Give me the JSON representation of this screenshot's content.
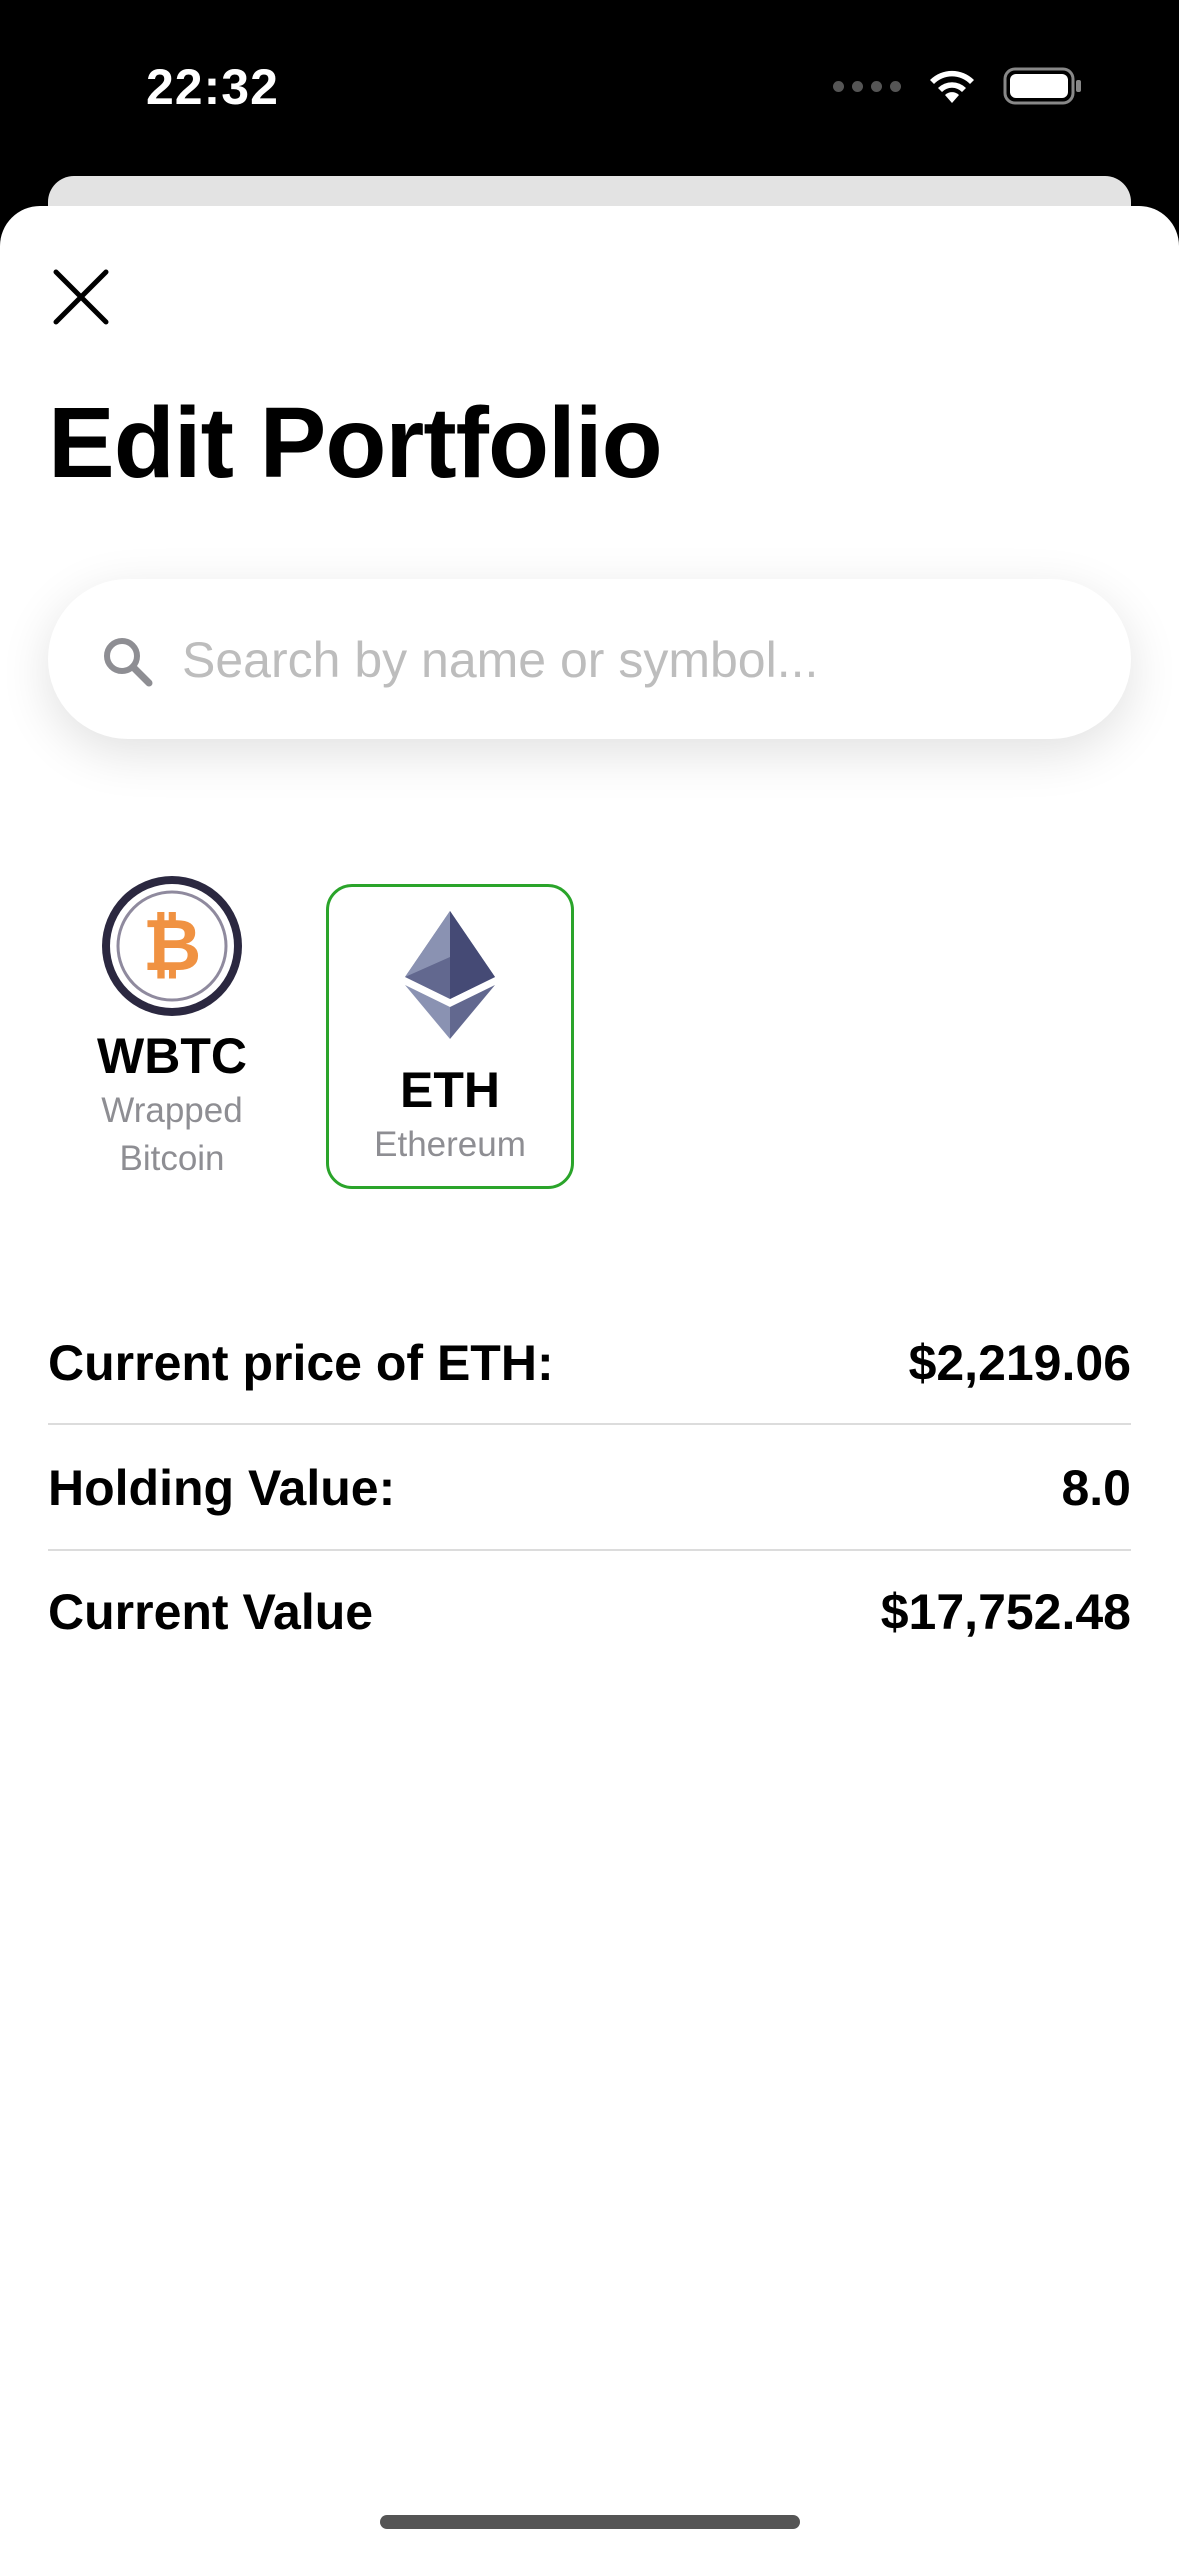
{
  "status": {
    "time": "22:32"
  },
  "header": {
    "title": "Edit Portfolio"
  },
  "search": {
    "placeholder": "Search by name or symbol..."
  },
  "coins": [
    {
      "symbol": "WBTC",
      "name_line1": "Wrapped",
      "name_line2": "Bitcoin",
      "selected": false,
      "icon": "bitcoin-icon"
    },
    {
      "symbol": "ETH",
      "name_line1": "Ethereum",
      "selected": true,
      "icon": "ethereum-icon"
    }
  ],
  "details": [
    {
      "label": "Current price of ETH:",
      "value": "$2,219.06"
    },
    {
      "label": "Holding Value:",
      "value": "8.0"
    },
    {
      "label": "Current Value",
      "value": "$17,752.48"
    }
  ],
  "colors": {
    "selected_border": "#2aa42a",
    "bitcoin_orange": "#f09242",
    "eth_purple": "#62688f"
  }
}
